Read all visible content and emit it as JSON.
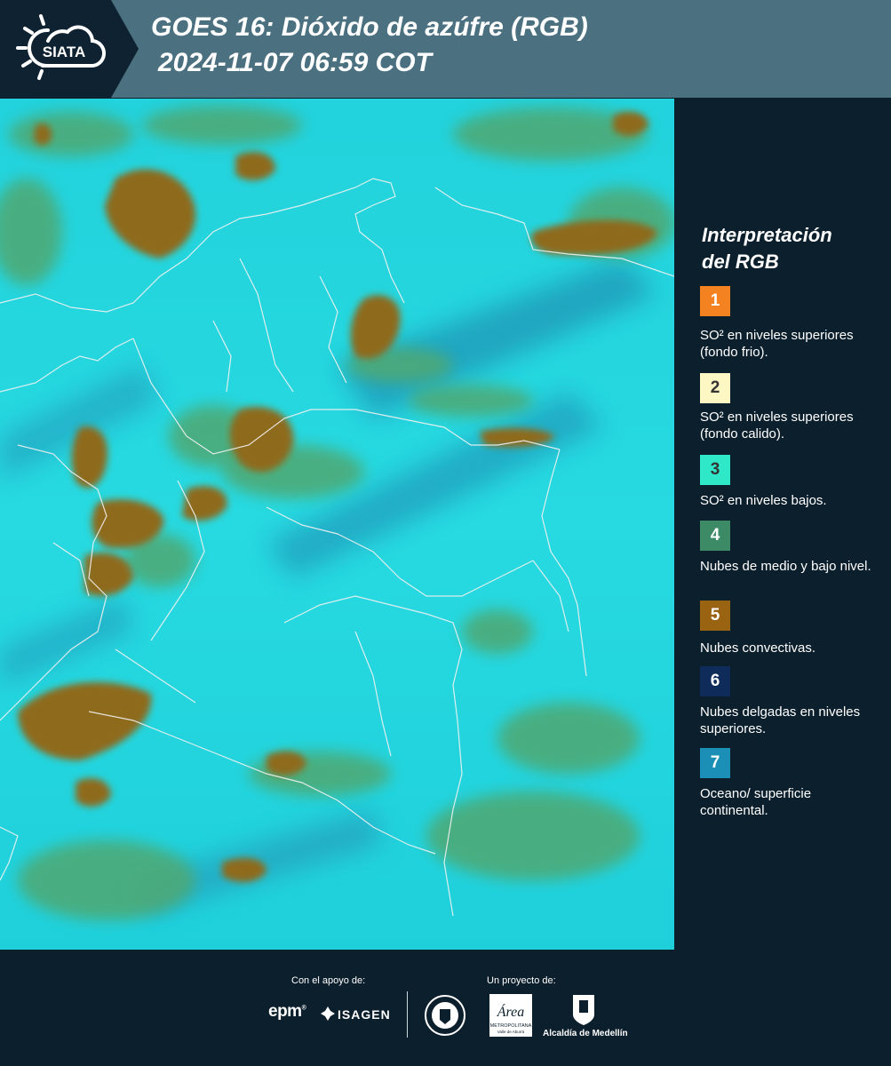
{
  "header": {
    "title": "GOES 16: Dióxido de azúfre (RGB)",
    "datetime": "2024-11-07 06:59 COT",
    "logo_text": "SIATA"
  },
  "legend": {
    "title_line1": "Interpretación",
    "title_line2": "del RGB",
    "items": [
      {
        "number": "1",
        "color": "#f58220",
        "text_color": "#ffffff",
        "label": "SO² en niveles superiores (fondo frio)."
      },
      {
        "number": "2",
        "color": "#fdf7c4",
        "text_color": "#333333",
        "label": "SO² en niveles superiores (fondo calido)."
      },
      {
        "number": "3",
        "color": "#2ee8c8",
        "text_color": "#333333",
        "label": "SO² en niveles bajos."
      },
      {
        "number": "4",
        "color": "#3c8a66",
        "text_color": "#ffffff",
        "label": "Nubes de medio y bajo nivel."
      },
      {
        "number": "5",
        "color": "#9a6312",
        "text_color": "#ffffff",
        "label": "Nubes convectivas."
      },
      {
        "number": "6",
        "color": "#0e2b5a",
        "text_color": "#ffffff",
        "label": "Nubes delgadas en niveles superiores."
      },
      {
        "number": "7",
        "color": "#1b8fb5",
        "text_color": "#ffffff",
        "label": "Oceano/ superficie continental."
      }
    ]
  },
  "footer": {
    "support_label": "Con el apoyo de:",
    "project_label": "Un proyecto de:",
    "epm": "epm",
    "isagen": "ISAGEN",
    "area_metro_script": "Área",
    "area_metro_line1": "METROPOLITANA",
    "area_metro_line2": "Valle de Aburrá",
    "alcaldia": "Alcaldía de Medellín"
  }
}
